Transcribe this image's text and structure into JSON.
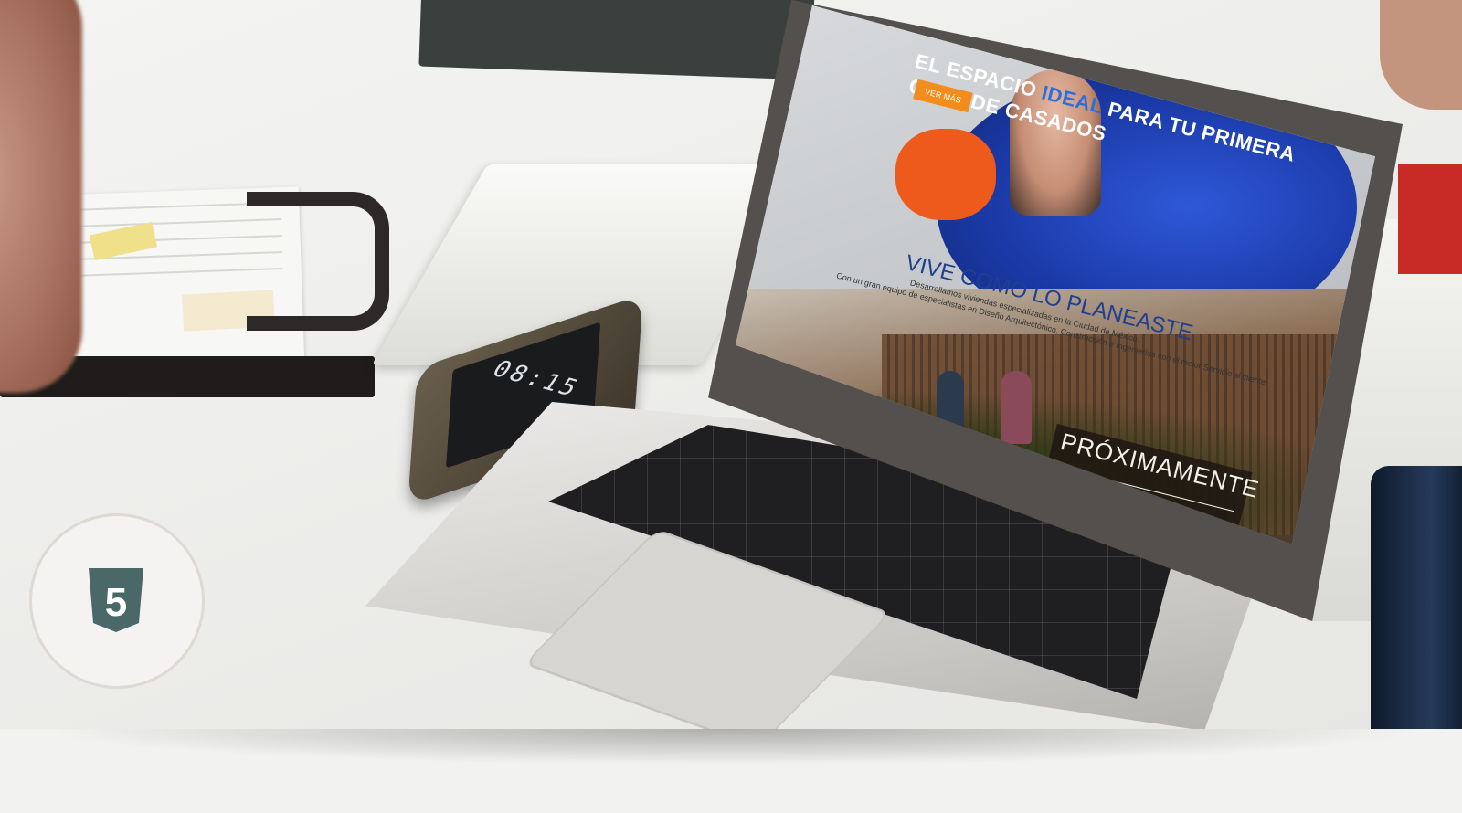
{
  "photo": {
    "phone_clock": "08:15",
    "badge_icon": "html5-shield-icon",
    "badge_icon_color": "#4b6868"
  },
  "website": {
    "hero_line1_pre": "EL ESPACIO ",
    "hero_line1_accent": "IDEAL",
    "hero_line1_post": " PARA TU PRIMERA",
    "hero_line2": "CENA DE CASADOS",
    "cta_label": "VER MÁS",
    "headline": "VIVE COMO LO PLANEASTE",
    "body_line1": "Desarrollamos viviendas especializadas en la Ciudad de México.",
    "body_line2": "Con un gran equipo de especialistas en Diseño Arquitectónico, Construcción e Ingenierías con el mejor Servicio al cliente.",
    "coming_soon": "PRÓXIMAMENTE",
    "accent_color": "#f28c1c",
    "headline_color": "#1f3f8f"
  }
}
